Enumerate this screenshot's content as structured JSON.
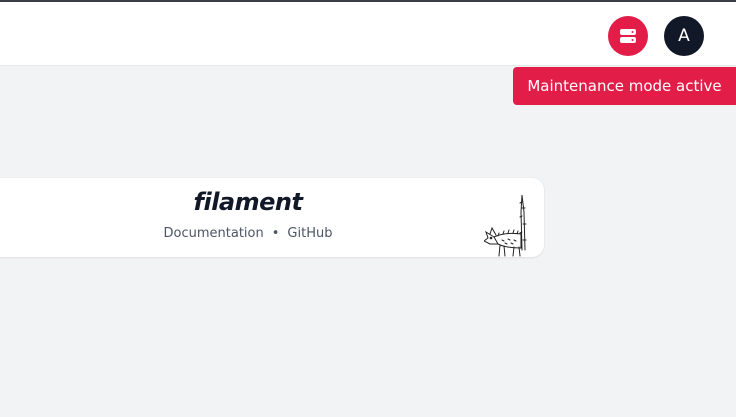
{
  "header": {
    "maintenance_icon": "server-stack-icon",
    "avatar_initial": "A",
    "colors": {
      "maintenance": "#e11d48",
      "avatar_bg": "#111827"
    }
  },
  "tooltip": {
    "text": "Maintenance mode active"
  },
  "footer_card": {
    "brand": "filament",
    "links": [
      "Documentation",
      "GitHub"
    ],
    "separator": "•",
    "illustration": "dog-sketch-icon"
  }
}
